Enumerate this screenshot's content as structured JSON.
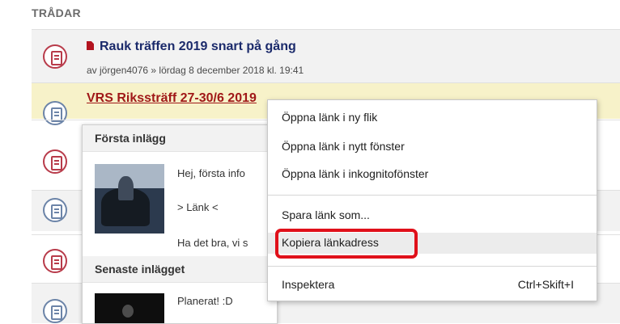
{
  "section": {
    "title": "TRÅDAR"
  },
  "threads": [
    {
      "title": "Rauk träffen 2019 snart på gång",
      "byline": "av jörgen4076 » lördag 8 december 2018 kl. 19:41"
    },
    {
      "title": "VRS Rikssträff 27-30/6 2019"
    }
  ],
  "preview": {
    "first_header": "Första inlägg",
    "first_lines": [
      "Hej, första info",
      "> Länk <",
      "Ha det bra, vi s"
    ],
    "latest_header": "Senaste inlägget",
    "latest_line": "Planerat! :D"
  },
  "context_menu": {
    "items": [
      {
        "label": "Öppna länk i ny flik"
      },
      {
        "label": "Öppna länk i nytt fönster"
      },
      {
        "label": "Öppna länk i inkognitofönster"
      },
      {
        "label": "Spara länk som..."
      },
      {
        "label": "Kopiera länkadress"
      },
      {
        "label": "Inspektera",
        "shortcut": "Ctrl+Skift+I"
      }
    ]
  },
  "colors": {
    "highlight_row": "#f7f2c9",
    "annotation": "#e0101a",
    "title_link": "#a01818"
  }
}
